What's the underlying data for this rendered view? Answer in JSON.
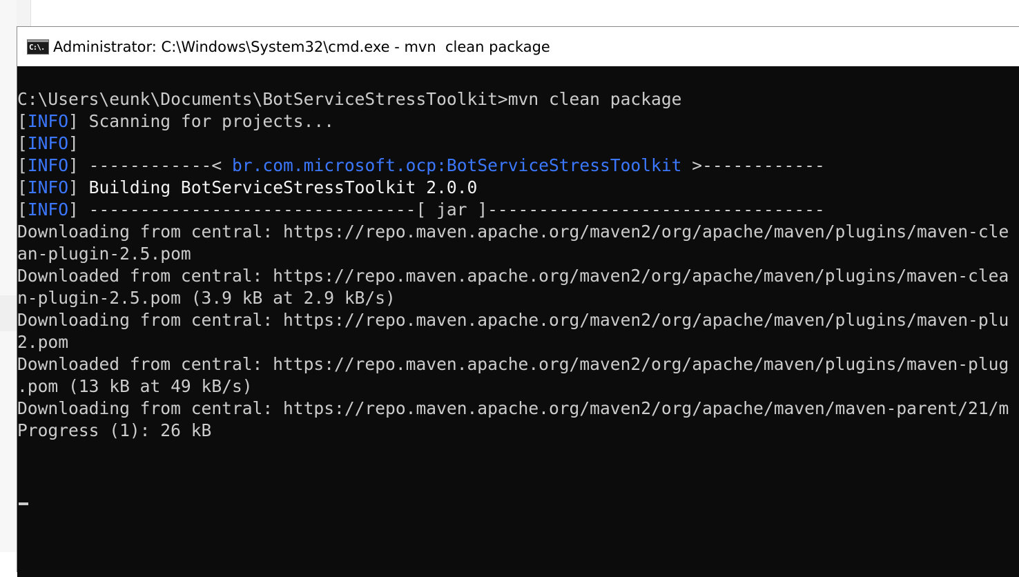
{
  "window": {
    "title": "Administrator: C:\\Windows\\System32\\cmd.exe - mvn  clean package",
    "icon": "cmd-icon",
    "icon_glyph": "C:\\."
  },
  "console": {
    "lines": [
      {
        "parts": [
          {
            "text": "C:\\Users\\eunk\\Documents\\BotServiceStressToolkit>mvn clean package",
            "color": "gray"
          }
        ]
      },
      {
        "parts": [
          {
            "text": "[",
            "color": "gray"
          },
          {
            "text": "INFO",
            "color": "blue"
          },
          {
            "text": "] Scanning for projects...",
            "color": "gray"
          }
        ]
      },
      {
        "parts": [
          {
            "text": "[",
            "color": "gray"
          },
          {
            "text": "INFO",
            "color": "blue"
          },
          {
            "text": "]",
            "color": "gray"
          }
        ]
      },
      {
        "parts": [
          {
            "text": "[",
            "color": "gray"
          },
          {
            "text": "INFO",
            "color": "blue"
          },
          {
            "text": "] ------------< ",
            "color": "gray"
          },
          {
            "text": "br.com.microsoft.ocp:BotServiceStressToolkit",
            "color": "blue"
          },
          {
            "text": " >------------",
            "color": "gray"
          }
        ]
      },
      {
        "parts": [
          {
            "text": "[",
            "color": "gray"
          },
          {
            "text": "INFO",
            "color": "blue"
          },
          {
            "text": "] ",
            "color": "gray"
          },
          {
            "text": "Building BotServiceStressToolkit 2.0.0",
            "color": "white"
          }
        ]
      },
      {
        "parts": [
          {
            "text": "[",
            "color": "gray"
          },
          {
            "text": "INFO",
            "color": "blue"
          },
          {
            "text": "] --------------------------------[ jar ]---------------------------------",
            "color": "gray"
          }
        ]
      },
      {
        "parts": [
          {
            "text": "Downloading from central: https://repo.maven.apache.org/maven2/org/apache/maven/plugins/maven-cle",
            "color": "gray"
          }
        ]
      },
      {
        "parts": [
          {
            "text": "an-plugin-2.5.pom",
            "color": "gray"
          }
        ]
      },
      {
        "parts": [
          {
            "text": "Downloaded from central: https://repo.maven.apache.org/maven2/org/apache/maven/plugins/maven-clea",
            "color": "gray"
          }
        ]
      },
      {
        "parts": [
          {
            "text": "n-plugin-2.5.pom (3.9 kB at 2.9 kB/s)",
            "color": "gray"
          }
        ]
      },
      {
        "parts": [
          {
            "text": "Downloading from central: https://repo.maven.apache.org/maven2/org/apache/maven/plugins/maven-plu",
            "color": "gray"
          }
        ]
      },
      {
        "parts": [
          {
            "text": "2.pom",
            "color": "gray"
          }
        ]
      },
      {
        "parts": [
          {
            "text": "Downloaded from central: https://repo.maven.apache.org/maven2/org/apache/maven/plugins/maven-plug",
            "color": "gray"
          }
        ]
      },
      {
        "parts": [
          {
            "text": ".pom (13 kB at 49 kB/s)",
            "color": "gray"
          }
        ]
      },
      {
        "parts": [
          {
            "text": "Downloading from central: https://repo.maven.apache.org/maven2/org/apache/maven/maven-parent/21/m",
            "color": "gray"
          }
        ]
      },
      {
        "parts": [
          {
            "text": "Progress (1): 26 kB",
            "color": "gray"
          }
        ]
      }
    ]
  },
  "colors": {
    "background": "#0c0c0c",
    "text": "#cccccc",
    "info_blue": "#3b78ff",
    "bright": "#f2f2f2",
    "titlebar": "#ffffff"
  }
}
